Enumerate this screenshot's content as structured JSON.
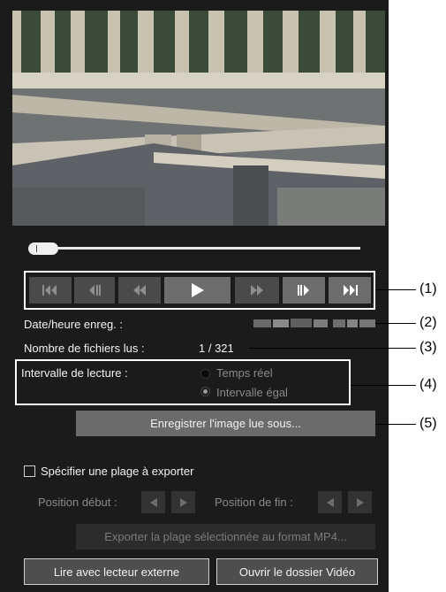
{
  "controls": {
    "buttons": [
      {
        "icon": "skip-to-start-icon",
        "state": "disabled"
      },
      {
        "icon": "step-back-icon",
        "state": "disabled"
      },
      {
        "icon": "rewind-icon",
        "state": "disabled"
      },
      {
        "icon": "play-icon",
        "state": "enabled"
      },
      {
        "icon": "fast-forward-icon",
        "state": "disabled"
      },
      {
        "icon": "step-forward-icon",
        "state": "enabled"
      },
      {
        "icon": "skip-to-end-icon",
        "state": "enabled"
      }
    ]
  },
  "seek": {
    "position_fraction": 0.03
  },
  "info": {
    "date_label": "Date/heure enreg. :",
    "files_label": "Nombre de fichiers lus :",
    "files_value": "1 / 321"
  },
  "interval": {
    "label": "Intervalle de lecture :",
    "option_realtime": "Temps réel",
    "option_equal": "Intervalle égal",
    "selected": "option_equal"
  },
  "buttons": {
    "save_image": "Enregistrer l'image lue sous...",
    "export_mp4": "Exporter la plage sélectionnée au format MP4...",
    "external_player": "Lire avec lecteur externe",
    "open_folder": "Ouvrir le dossier Vidéo"
  },
  "export": {
    "checkbox_label": "Spécifier une plage à exporter",
    "start_label": "Position début :",
    "end_label": "Position de fin :"
  },
  "callouts": [
    "(1)",
    "(2)",
    "(3)",
    "(4)",
    "(5)"
  ],
  "colors": {
    "panel": "#1b1b1b",
    "button": "#6b6b6b",
    "highlight": "#ffffff"
  }
}
